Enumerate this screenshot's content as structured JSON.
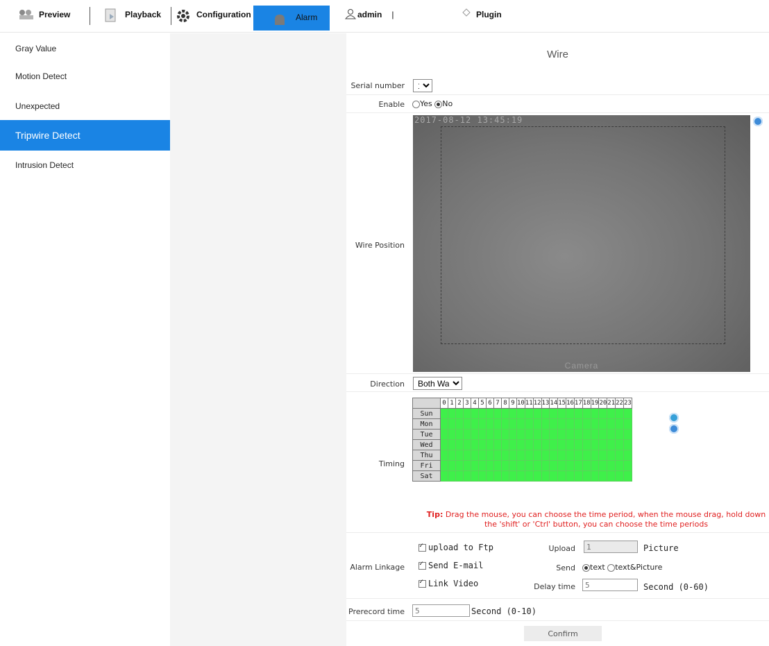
{
  "nav": {
    "preview": "Preview",
    "playback": "Playback",
    "configuration": "Configuration",
    "alarm": "Alarm",
    "user": "admin",
    "user_sep": "|",
    "plugin": "Plugin"
  },
  "sidebar": {
    "items": [
      {
        "label": "Gray Value"
      },
      {
        "label": "Motion Detect"
      },
      {
        "label": "Unexpected"
      },
      {
        "label": "Tripwire Detect"
      },
      {
        "label": "Intrusion Detect"
      }
    ]
  },
  "panel": {
    "title": "Wire",
    "serial_label": "Serial number",
    "serial_value": "1",
    "enable_label": "Enable",
    "enable_yes": "Yes",
    "enable_no": "No",
    "wire_position_label": "Wire Position",
    "video_timestamp": "2017-08-12 13:45:19",
    "video_camera_label": "Camera",
    "direction_label": "Direction",
    "direction_value": "Both Way",
    "timing_label": "Timing",
    "days": [
      "Sun",
      "Mon",
      "Tue",
      "Wed",
      "Thu",
      "Fri",
      "Sat"
    ],
    "hours": [
      "0",
      "1",
      "2",
      "3",
      "4",
      "5",
      "6",
      "7",
      "8",
      "9",
      "10",
      "11",
      "12",
      "13",
      "14",
      "15",
      "16",
      "17",
      "18",
      "19",
      "20",
      "21",
      "22",
      "23"
    ],
    "tip_prefix": "Tip:",
    "tip_text": "Drag the mouse, you can choose the time period, when the mouse drag, hold down the 'shift' or 'Ctrl' button, you can choose the time periods",
    "alarm_linkage_label": "Alarm Linkage",
    "upload_ftp": "upload to Ftp",
    "send_email": "Send E-mail",
    "link_video": "Link Video",
    "upload_label": "Upload",
    "upload_value": "1",
    "upload_unit": "Picture",
    "send_label": "Send",
    "send_text": "text",
    "send_text_picture": "text&Picture",
    "delay_label": "Delay time",
    "delay_value": "5",
    "delay_unit": "Second (0-60)",
    "prerecord_label": "Prerecord time",
    "prerecord_value": "5",
    "prerecord_unit": "Second (0-10)",
    "confirm": "Confirm"
  },
  "colors": {
    "accent": "#1a84e4",
    "schedule_on": "#3ff04a",
    "tip": "#e02020"
  }
}
